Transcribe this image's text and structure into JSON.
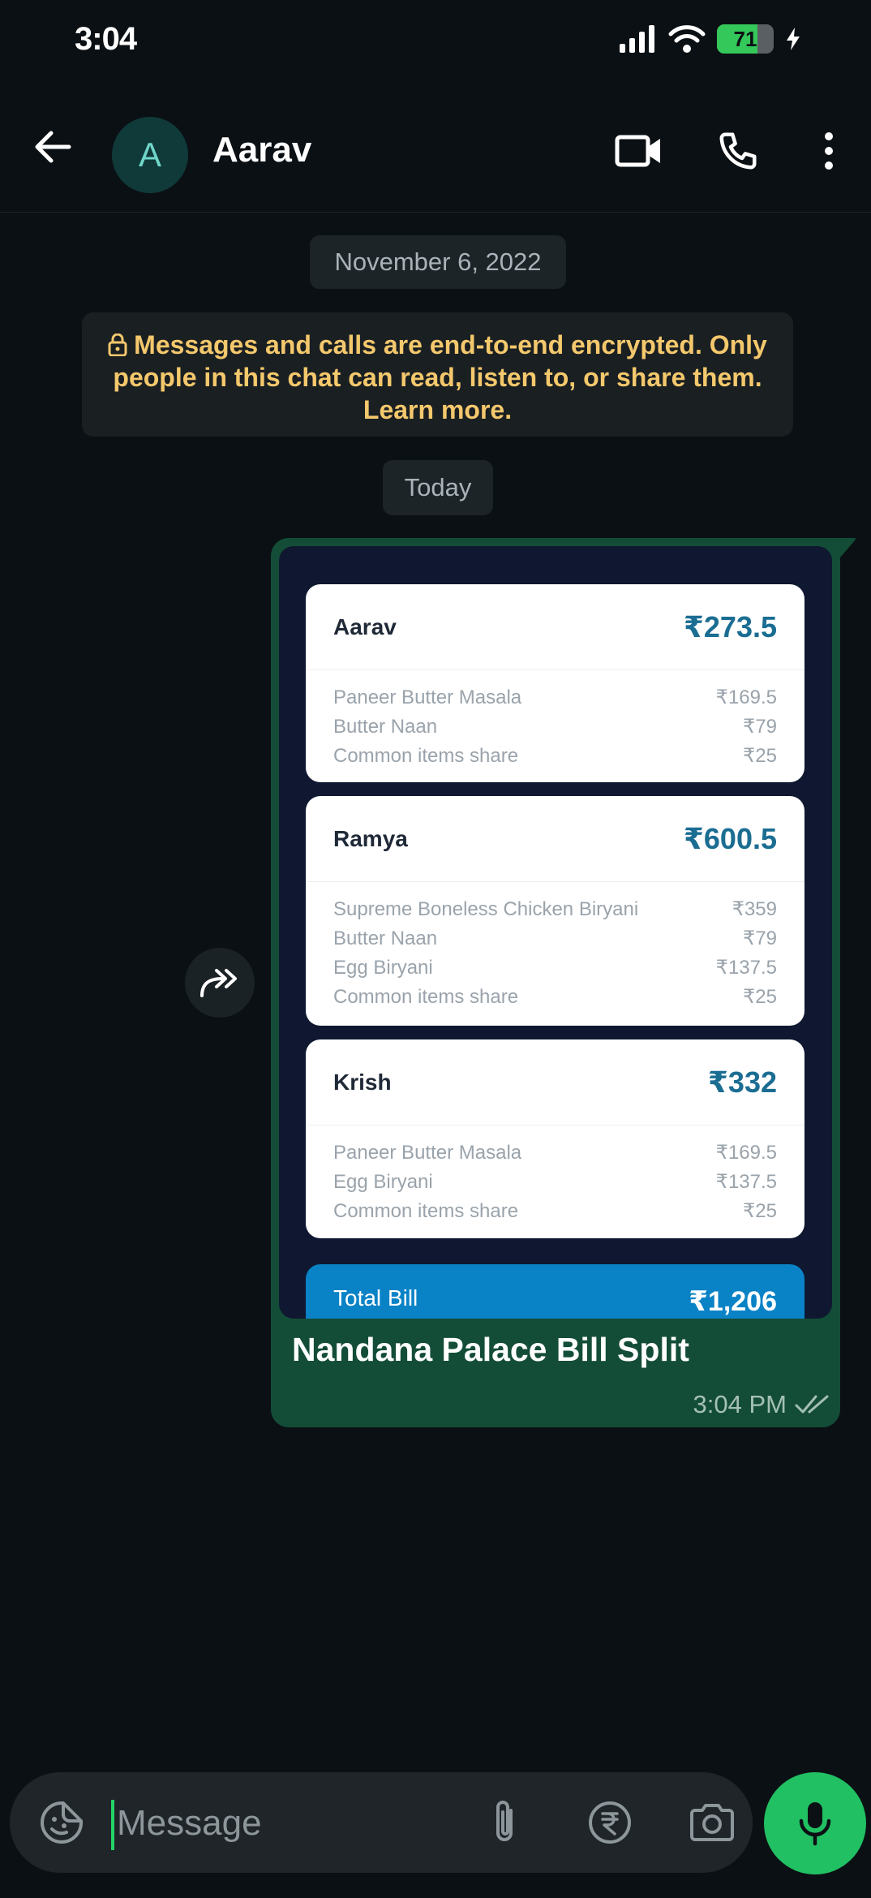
{
  "status_bar": {
    "time": "3:04",
    "battery": "71",
    "battery_level": 0.71
  },
  "header": {
    "avatar_letter": "A",
    "contact_name": "Aarav"
  },
  "chat": {
    "date_chip": "November 6, 2022",
    "encryption_notice": "Messages and calls are end-to-end encrypted. Only people in this chat can read, listen to, or share them. Learn more.",
    "today_chip": "Today"
  },
  "message": {
    "title": "Nandana Palace Bill Split",
    "time": "3:04 PM",
    "cards": [
      {
        "name": "Aarav",
        "amount": "₹273.5",
        "items": [
          {
            "label": "Paneer Butter Masala",
            "price": "₹169.5"
          },
          {
            "label": "Butter Naan",
            "price": "₹79"
          },
          {
            "label": "Common items share",
            "price": "₹25"
          }
        ]
      },
      {
        "name": "Ramya",
        "amount": "₹600.5",
        "items": [
          {
            "label": "Supreme Boneless Chicken Biryani",
            "price": "₹359"
          },
          {
            "label": "Butter Naan",
            "price": "₹79"
          },
          {
            "label": "Egg Biryani",
            "price": "₹137.5"
          },
          {
            "label": "Common items share",
            "price": "₹25"
          }
        ]
      },
      {
        "name": "Krish",
        "amount": "₹332",
        "items": [
          {
            "label": "Paneer Butter Masala",
            "price": "₹169.5"
          },
          {
            "label": "Egg Biryani",
            "price": "₹137.5"
          },
          {
            "label": "Common items share",
            "price": "₹25"
          }
        ]
      }
    ],
    "total_label": "Total Bill",
    "total_value": "₹1,206"
  },
  "input": {
    "placeholder": "Message"
  },
  "colors": {
    "accent": "#25d366",
    "bubble_out": "#134d37",
    "notice_text": "#f4c86c",
    "amount": "#1b6d92",
    "total_bar": "#0a82c6"
  },
  "icons": [
    "back-arrow-icon",
    "video-call-icon",
    "phone-icon",
    "more-icon",
    "lock-icon",
    "forward-icon",
    "double-check-icon",
    "sticker-icon",
    "attach-icon",
    "rupee-icon",
    "camera-icon",
    "mic-icon"
  ]
}
